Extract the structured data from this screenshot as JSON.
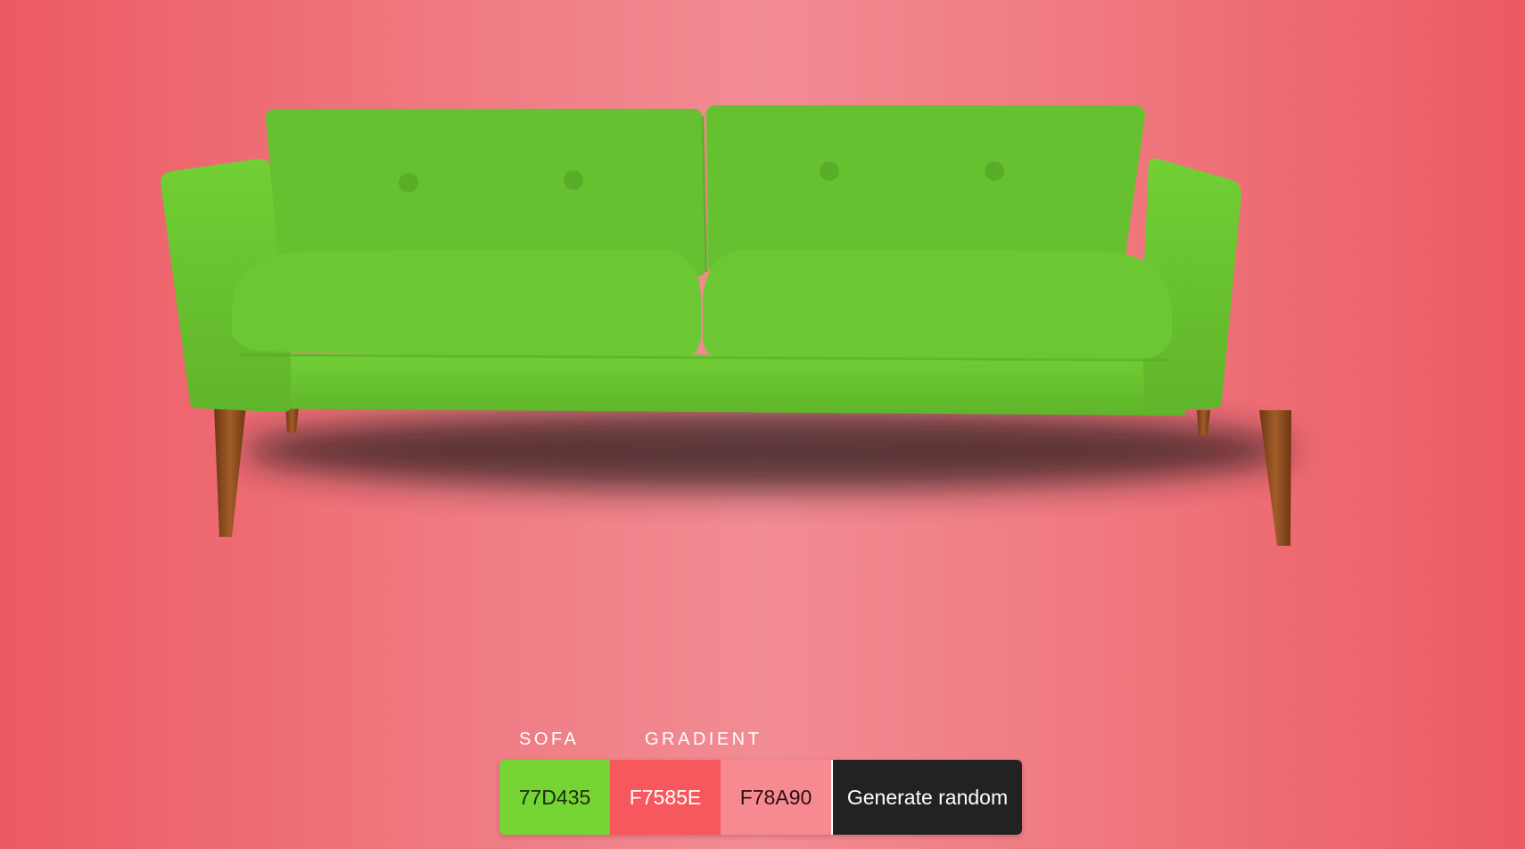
{
  "labels": {
    "sofa": "SOFA",
    "gradient": "GRADIENT"
  },
  "swatches": [
    {
      "text": "77D435",
      "color": "#77D435"
    },
    {
      "text": "F7585E",
      "color": "#F7585E"
    },
    {
      "text": "F78A90",
      "color": "#F78A90"
    }
  ],
  "generate_label": "Generate random",
  "colors": {
    "sofa_fabric": "#6cc832",
    "sofa_shade": "#5aae27",
    "leg_wood": "#8a4a1e",
    "background_edge": "#ec5a62",
    "background_center": "#f28c93",
    "button_dark": "#222222"
  }
}
